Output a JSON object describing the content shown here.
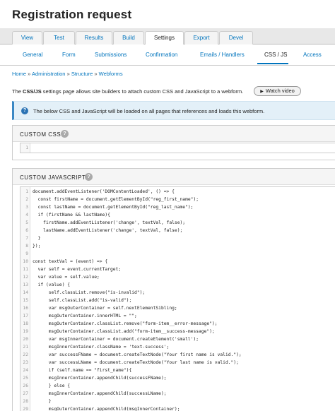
{
  "header": {
    "title": "Registration request",
    "star_icon": "star-outline-icon"
  },
  "primary_tabs": [
    {
      "label": "View"
    },
    {
      "label": "Test"
    },
    {
      "label": "Results"
    },
    {
      "label": "Build"
    },
    {
      "label": "Settings"
    },
    {
      "label": "Export"
    },
    {
      "label": "Devel"
    }
  ],
  "secondary_tabs": [
    {
      "label": "General"
    },
    {
      "label": "Form"
    },
    {
      "label": "Submissions"
    },
    {
      "label": "Confirmation"
    },
    {
      "label": "Emails / Handlers"
    },
    {
      "label": "CSS / JS"
    },
    {
      "label": "Access"
    }
  ],
  "breadcrumb": {
    "items": [
      "Home",
      "Administration",
      "Structure",
      "Webforms"
    ],
    "separator": "»"
  },
  "intro": {
    "prefix": "The ",
    "bold": "CSS/JS",
    "rest": " settings page allows site builders to attach custom CSS and JavaScript to a webform.",
    "watch_label": "Watch video"
  },
  "info_message": "The below CSS and JavaScript will be loaded on all pages that references and loads this webform.",
  "custom_css": {
    "title": "CUSTOM CSS",
    "lines": [
      ""
    ]
  },
  "custom_js": {
    "title": "CUSTOM JAVASCRIPT",
    "lines": [
      "document.addEventListener('DOMContentLoaded', () => {",
      "  const firstName = document.getElementById(\"reg_first_name\");",
      "  const lastName = document.getElementById(\"reg_last_name\");",
      "  if (firstName && lastName){",
      "    firstName.addEventListener('change', textVal, false);",
      "    lastName.addEventListener('change', textVal, false);",
      "  }",
      "});",
      "",
      "const textVal = (event) => {",
      "  var self = event.currentTarget;",
      "  var value = self.value;",
      "  if (value) {",
      "      self.classList.remove(\"is-invalid\");",
      "      self.classList.add(\"is-valid\");",
      "      var msgOuterContainer = self.nextElementSibling;",
      "      msgOuterContainer.innerHTML = \"\";",
      "      msgOuterContainer.classList.remove(\"form-item__error-message\");",
      "      msgOuterContainer.classList.add(\"form-item__success-message\");",
      "      var msgInnerContainer = document.createElement('small');",
      "      msgInnerContainer.className = 'text-success';",
      "      var successFName = document.createTextNode(\"Your first name is valid.\");",
      "      var successLName = document.createTextNode(\"Your last name is valid.\");",
      "      if (self.name == \"first_name\"){",
      "      msgInnerContainer.appendChild(successFName);",
      "      } else {",
      "      msgInnerContainer.appendChild(successLName);",
      "      }",
      "      msgOuterContainer.appendChild(msgInnerContainer);"
    ]
  },
  "colors": {
    "link": "#0074bd",
    "info_bg": "#e3f0f8",
    "info_border": "#3a88c4"
  }
}
